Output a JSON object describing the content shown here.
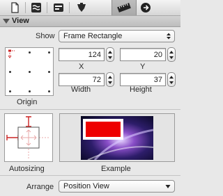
{
  "toolbar": {
    "tabs": [
      {
        "icon": "document-icon"
      },
      {
        "icon": "connections-icon"
      },
      {
        "icon": "attributes-icon"
      },
      {
        "icon": "identity-icon"
      },
      {
        "icon": "size-ruler-icon",
        "selected": true
      },
      {
        "icon": "navigate-forward-icon"
      }
    ]
  },
  "section": {
    "title": "View",
    "expanded": true
  },
  "show": {
    "label": "Show",
    "value": "Frame Rectangle"
  },
  "frame": {
    "x": {
      "value": "124",
      "label": "X"
    },
    "y": {
      "value": "20",
      "label": "Y"
    },
    "width": {
      "value": "72",
      "label": "Width"
    },
    "height": {
      "value": "37",
      "label": "Height"
    }
  },
  "origin": {
    "label": "Origin"
  },
  "autosizing": {
    "label": "Autosizing"
  },
  "example": {
    "label": "Example"
  },
  "arrange": {
    "label": "Arrange",
    "value": "Position View"
  },
  "colors": {
    "strut": "#cc2222",
    "spring": "#e8a8a8",
    "example_rect": "#ee0000"
  }
}
